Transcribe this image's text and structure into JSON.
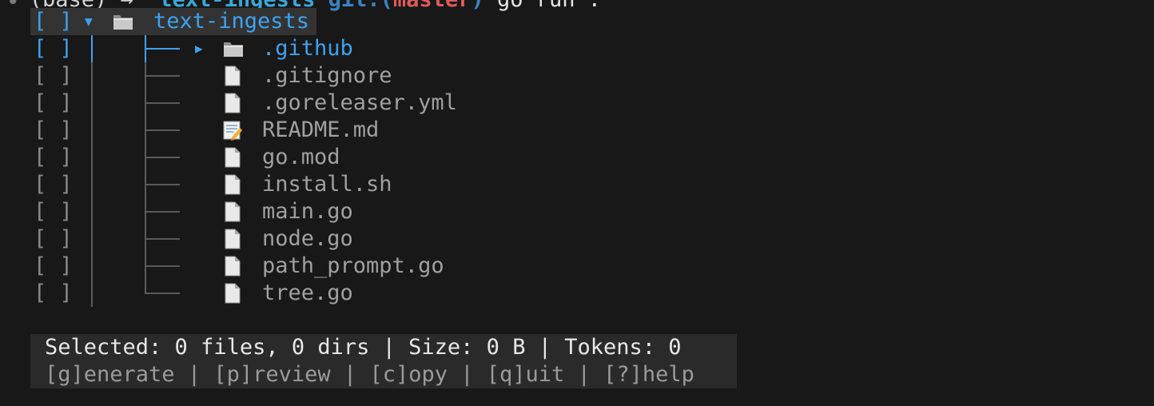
{
  "prompt": {
    "env": "(base)",
    "arrow": "→",
    "dir": "text-ingests",
    "git_label": "git:(",
    "branch": "master",
    "git_close": ")",
    "command": "go run ."
  },
  "tree": {
    "root": {
      "checkbox": "[ ]",
      "expander": "▼",
      "icon": "folder-icon",
      "name": "text-ingests"
    },
    "items": [
      {
        "checkbox": "[ ]",
        "expander": "▶",
        "icon": "folder-icon",
        "name": ".github",
        "active": true,
        "last": false
      },
      {
        "checkbox": "[ ]",
        "expander": "",
        "icon": "file-icon",
        "name": ".gitignore",
        "active": false,
        "last": false
      },
      {
        "checkbox": "[ ]",
        "expander": "",
        "icon": "file-icon",
        "name": ".goreleaser.yml",
        "active": false,
        "last": false
      },
      {
        "checkbox": "[ ]",
        "expander": "",
        "icon": "memo-icon",
        "name": "README.md",
        "active": false,
        "last": false
      },
      {
        "checkbox": "[ ]",
        "expander": "",
        "icon": "file-icon",
        "name": "go.mod",
        "active": false,
        "last": false
      },
      {
        "checkbox": "[ ]",
        "expander": "",
        "icon": "file-icon",
        "name": "install.sh",
        "active": false,
        "last": false
      },
      {
        "checkbox": "[ ]",
        "expander": "",
        "icon": "file-icon",
        "name": "main.go",
        "active": false,
        "last": false
      },
      {
        "checkbox": "[ ]",
        "expander": "",
        "icon": "file-icon",
        "name": "node.go",
        "active": false,
        "last": false
      },
      {
        "checkbox": "[ ]",
        "expander": "",
        "icon": "file-icon",
        "name": "path_prompt.go",
        "active": false,
        "last": false
      },
      {
        "checkbox": "[ ]",
        "expander": "",
        "icon": "file-icon",
        "name": "tree.go",
        "active": false,
        "last": true
      }
    ]
  },
  "status": {
    "summary": "Selected: 0 files, 0 dirs | Size: 0 B | Tokens: 0",
    "keys": [
      {
        "label": "[g]enerate"
      },
      {
        "label": "[p]review"
      },
      {
        "label": "[c]opy"
      },
      {
        "label": "[q]uit"
      },
      {
        "label": "[?]help"
      }
    ],
    "separator": " | "
  },
  "colors": {
    "accent": "#3ea2f0",
    "background": "#181818",
    "status_bg": "#2a2a2a",
    "highlight_bg": "#333333",
    "branch": "#e05a5a"
  }
}
